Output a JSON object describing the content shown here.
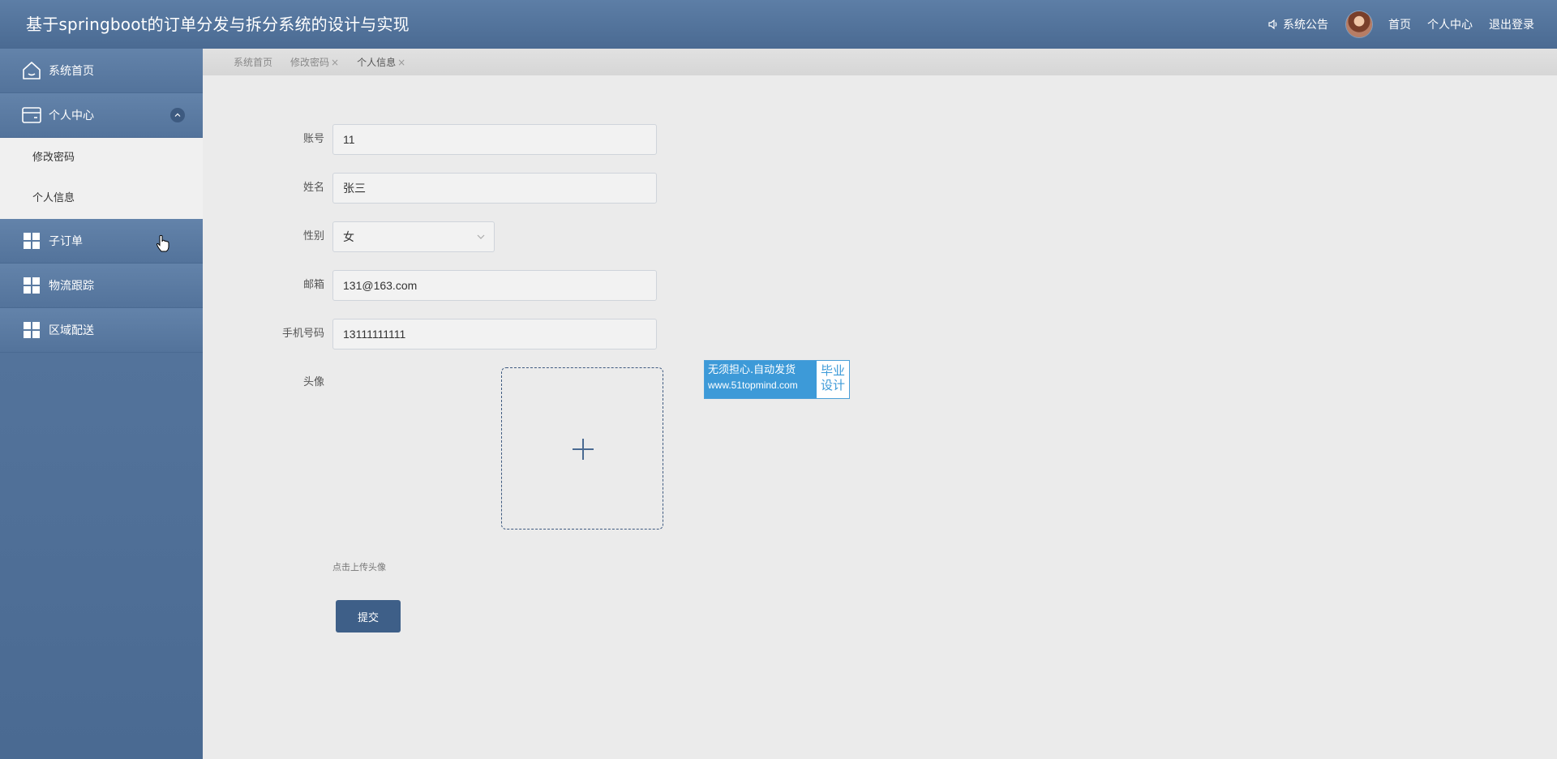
{
  "header": {
    "title": "基于springboot的订单分发与拆分系统的设计与实现",
    "notice_label": "系统公告",
    "home_label": "首页",
    "profile_label": "个人中心",
    "logout_label": "退出登录"
  },
  "sidebar": {
    "items": [
      {
        "label": "系统首页",
        "icon": "home-icon"
      },
      {
        "label": "个人中心",
        "icon": "wallet-icon",
        "expanded": true,
        "children": [
          {
            "label": "修改密码"
          },
          {
            "label": "个人信息"
          }
        ]
      },
      {
        "label": "子订单",
        "icon": "grid-icon"
      },
      {
        "label": "物流跟踪",
        "icon": "grid-icon"
      },
      {
        "label": "区域配送",
        "icon": "grid-icon"
      }
    ]
  },
  "tabs": [
    {
      "label": "系统首页",
      "closable": false
    },
    {
      "label": "修改密码",
      "closable": true
    },
    {
      "label": "个人信息",
      "closable": true,
      "active": true
    }
  ],
  "form": {
    "account": {
      "label": "账号",
      "value": "11"
    },
    "name": {
      "label": "姓名",
      "value": "张三"
    },
    "gender": {
      "label": "性别",
      "value": "女"
    },
    "email": {
      "label": "邮箱",
      "value": "131@163.com"
    },
    "phone": {
      "label": "手机号码",
      "value": "13111111111"
    },
    "avatar": {
      "label": "头像",
      "hint": "点击上传头像"
    },
    "submit_label": "提交"
  },
  "ad": {
    "line1": "无须担心.自动发货",
    "line2": "www.51topmind.com",
    "side1": "毕业",
    "side2": "设计"
  },
  "colors": {
    "header": "#5d7ea6",
    "sidebar": "#5a7aa2",
    "accent": "#3e5f88",
    "ad_blue": "#3d9ad8"
  }
}
